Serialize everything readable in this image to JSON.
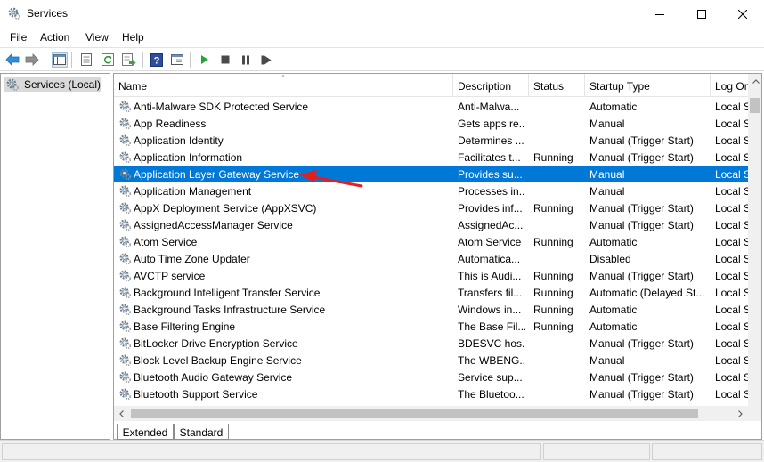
{
  "window": {
    "title": "Services",
    "minimize_icon": "minimize-icon",
    "maximize_icon": "maximize-icon",
    "close_icon": "close-icon"
  },
  "menu": [
    "File",
    "Action",
    "View",
    "Help"
  ],
  "toolbar": {
    "icons": [
      "back-arrow-icon",
      "forward-arrow-icon",
      "show-hide-console-tree-icon",
      "properties-icon",
      "refresh-icon",
      "export-list-icon",
      "help-icon",
      "show-hide-action-pane-icon",
      "start-service-icon",
      "stop-service-icon",
      "pause-service-icon",
      "restart-service-icon"
    ]
  },
  "tree": {
    "label": "Services (Local)"
  },
  "table": {
    "columns": [
      "Name",
      "Description",
      "Status",
      "Startup Type",
      "Log On"
    ],
    "rows": [
      {
        "name": "Anti-Malware SDK Protected Service",
        "description": "Anti-Malwa...",
        "status": "",
        "startup": "Automatic",
        "logon": "Local S"
      },
      {
        "name": "App Readiness",
        "description": "Gets apps re...",
        "status": "",
        "startup": "Manual",
        "logon": "Local S"
      },
      {
        "name": "Application Identity",
        "description": "Determines ...",
        "status": "",
        "startup": "Manual (Trigger Start)",
        "logon": "Local S"
      },
      {
        "name": "Application Information",
        "description": "Facilitates t...",
        "status": "Running",
        "startup": "Manual (Trigger Start)",
        "logon": "Local S"
      },
      {
        "name": "Application Layer Gateway Service",
        "description": "Provides su...",
        "status": "",
        "startup": "Manual",
        "logon": "Local S"
      },
      {
        "name": "Application Management",
        "description": "Processes in...",
        "status": "",
        "startup": "Manual",
        "logon": "Local S"
      },
      {
        "name": "AppX Deployment Service (AppXSVC)",
        "description": "Provides inf...",
        "status": "Running",
        "startup": "Manual (Trigger Start)",
        "logon": "Local S"
      },
      {
        "name": "AssignedAccessManager Service",
        "description": "AssignedAc...",
        "status": "",
        "startup": "Manual (Trigger Start)",
        "logon": "Local S"
      },
      {
        "name": "Atom Service",
        "description": "Atom Service",
        "status": "Running",
        "startup": "Automatic",
        "logon": "Local S"
      },
      {
        "name": "Auto Time Zone Updater",
        "description": "Automatica...",
        "status": "",
        "startup": "Disabled",
        "logon": "Local S"
      },
      {
        "name": "AVCTP service",
        "description": "This is Audi...",
        "status": "Running",
        "startup": "Manual (Trigger Start)",
        "logon": "Local S"
      },
      {
        "name": "Background Intelligent Transfer Service",
        "description": "Transfers fil...",
        "status": "Running",
        "startup": "Automatic (Delayed St...",
        "logon": "Local S"
      },
      {
        "name": "Background Tasks Infrastructure Service",
        "description": "Windows in...",
        "status": "Running",
        "startup": "Automatic",
        "logon": "Local S"
      },
      {
        "name": "Base Filtering Engine",
        "description": "The Base Fil...",
        "status": "Running",
        "startup": "Automatic",
        "logon": "Local S"
      },
      {
        "name": "BitLocker Drive Encryption Service",
        "description": "BDESVC hos...",
        "status": "",
        "startup": "Manual (Trigger Start)",
        "logon": "Local S"
      },
      {
        "name": "Block Level Backup Engine Service",
        "description": "The WBENG...",
        "status": "",
        "startup": "Manual",
        "logon": "Local S"
      },
      {
        "name": "Bluetooth Audio Gateway Service",
        "description": "Service sup...",
        "status": "",
        "startup": "Manual (Trigger Start)",
        "logon": "Local S"
      },
      {
        "name": "Bluetooth Support Service",
        "description": "The Bluetoo...",
        "status": "",
        "startup": "Manual (Trigger Start)",
        "logon": "Local S"
      }
    ],
    "selected_index": 4
  },
  "tabs": [
    "Extended",
    "Standard"
  ],
  "colors": {
    "selection": "#0078d7",
    "annotation_arrow": "#e02020"
  }
}
